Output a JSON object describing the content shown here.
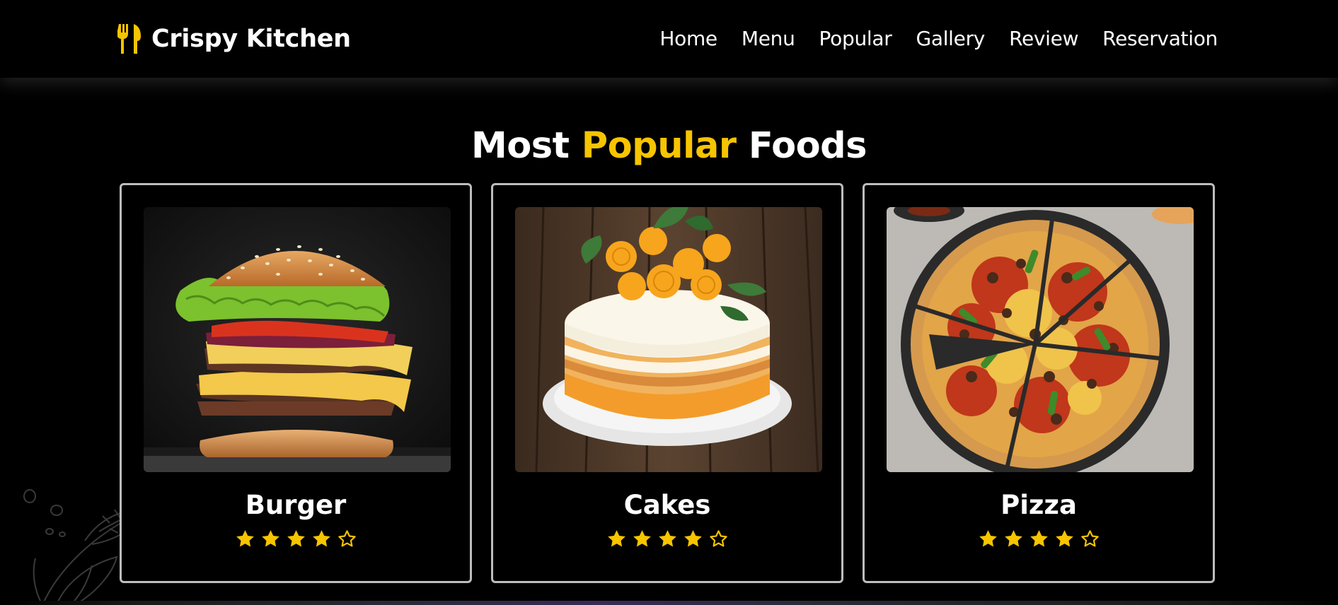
{
  "brand": {
    "name": "Crispy Kitchen",
    "icon": "utensils-icon",
    "accent_color": "#f7c400"
  },
  "nav": {
    "items": [
      {
        "label": "Home"
      },
      {
        "label": "Menu"
      },
      {
        "label": "Popular"
      },
      {
        "label": "Gallery"
      },
      {
        "label": "Review"
      },
      {
        "label": "Reservation"
      }
    ]
  },
  "section": {
    "title_prefix": "Most",
    "title_highlight": "Popular",
    "title_suffix": "Foods"
  },
  "foods": [
    {
      "name": "Burger",
      "image": "burger-photo",
      "rating": 4,
      "max_rating": 5
    },
    {
      "name": "Cakes",
      "image": "cake-photo",
      "rating": 4,
      "max_rating": 5
    },
    {
      "name": "Pizza",
      "image": "pizza-photo",
      "rating": 4,
      "max_rating": 5
    }
  ],
  "colors": {
    "background": "#000000",
    "text": "#ffffff",
    "accent": "#f7c400",
    "card_border": "#bdbdbd"
  }
}
